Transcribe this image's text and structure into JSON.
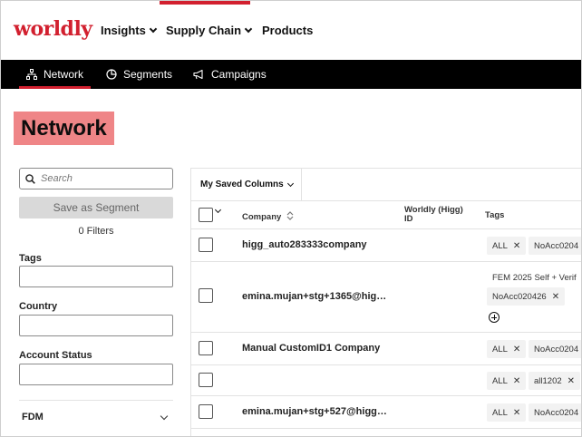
{
  "brand": {
    "logo_text": "worldly",
    "accent": "#d2202f",
    "title_bg": "#ef8587"
  },
  "topnav": {
    "items": [
      {
        "label": "Insights",
        "icon": "chevron-down-icon"
      },
      {
        "label": "Supply Chain",
        "icon": "chevron-down-icon"
      },
      {
        "label": "Products"
      }
    ]
  },
  "subnav": {
    "items": [
      {
        "label": "Network",
        "icon": "network-icon",
        "active": true
      },
      {
        "label": "Segments",
        "icon": "pie-chart-icon"
      },
      {
        "label": "Campaigns",
        "icon": "megaphone-icon"
      }
    ]
  },
  "page": {
    "title": "Network"
  },
  "filters": {
    "search_placeholder": "Search",
    "save_segment": "Save as Segment",
    "count_text": "0 Filters",
    "tags_label": "Tags",
    "country_label": "Country",
    "account_status_label": "Account Status",
    "fdm_label": "FDM"
  },
  "table": {
    "saved_columns": "My Saved Columns",
    "headers": {
      "company": "Company",
      "worldly_id_1": "Worldly (Higg)",
      "worldly_id_2": "ID",
      "tags": "Tags"
    },
    "rows": [
      {
        "company": "higg_auto283333company",
        "tags": [
          "ALL",
          "NoAcc0204"
        ]
      },
      {
        "company": "emina.mujan+stg+1365@hig…",
        "tag_top": "FEM 2025 Self + Verif",
        "tags": [
          "NoAcc020426"
        ]
      },
      {
        "company": "Manual CustomID1 Company",
        "tags": [
          "ALL",
          "NoAcc0204"
        ]
      },
      {
        "company": "",
        "tags": [
          "ALL",
          "all1202"
        ]
      },
      {
        "company": "emina.mujan+stg+527@higg…",
        "tags": [
          "ALL",
          "NoAcc0204"
        ]
      }
    ]
  }
}
